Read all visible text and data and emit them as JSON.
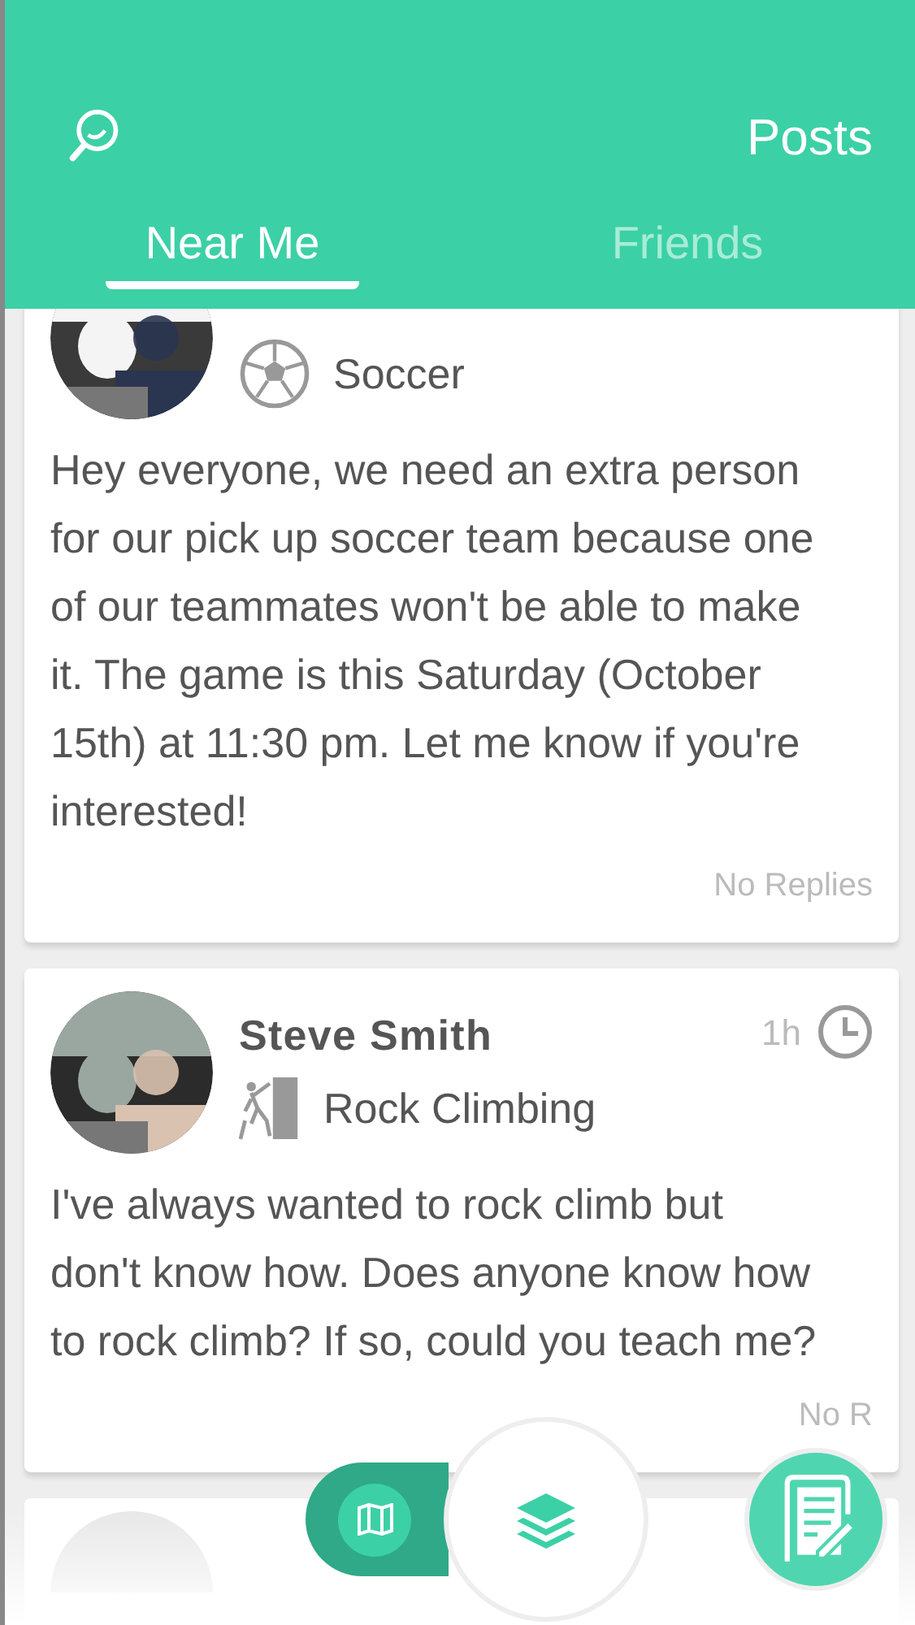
{
  "header": {
    "title": "Posts"
  },
  "tabs": [
    {
      "label": "Near Me",
      "selected": true
    },
    {
      "label": "Friends",
      "selected": false
    }
  ],
  "posts": [
    {
      "activity": "Soccer",
      "kind": "soccer",
      "body": "Hey everyone, we need an extra person for our pick up soccer team because one of our teammates won't be able to make it. The game is this Saturday (October 15th) at 11:30 pm. Let me know if you're interested!",
      "replies": "No Replies"
    },
    {
      "name": "Steve Smith",
      "time": "1h",
      "activity": "Rock Climbing",
      "kind": "climbing",
      "body": "I've always wanted to rock climb but don't know how. Does anyone know how to rock climb? If so, could you teach me?",
      "replies": "No R"
    }
  ],
  "view_modes": [
    {
      "selected": false
    },
    {
      "selected": true
    }
  ]
}
